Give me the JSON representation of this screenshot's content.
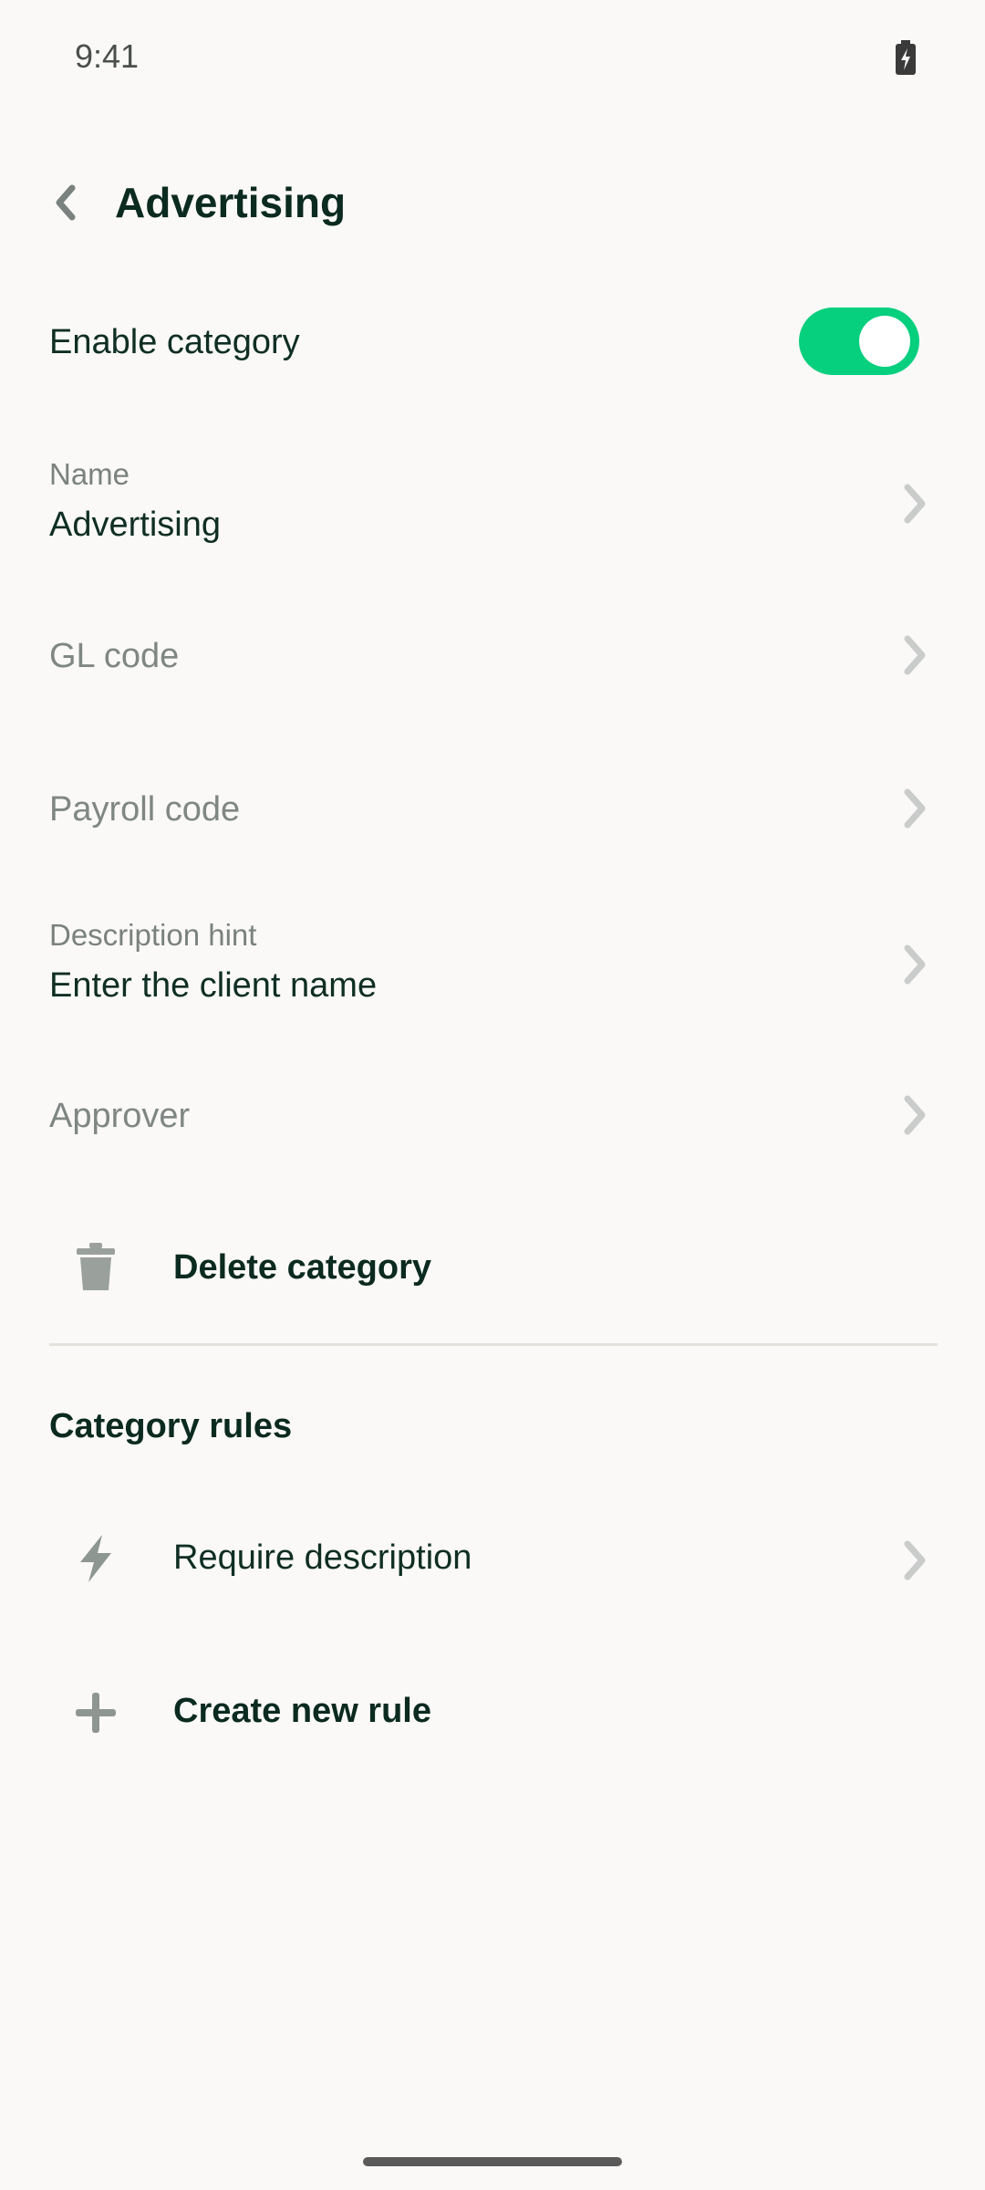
{
  "status_bar": {
    "time": "9:41",
    "battery_icon": "battery-charging-icon"
  },
  "header": {
    "back_icon": "chevron-left-icon",
    "title": "Advertising"
  },
  "enable": {
    "label": "Enable category",
    "enabled": true
  },
  "fields": {
    "name": {
      "label": "Name",
      "value": "Advertising"
    },
    "gl_code": {
      "placeholder": "GL code"
    },
    "payroll_code": {
      "placeholder": "Payroll code"
    },
    "description_hint": {
      "label": "Description hint",
      "value": "Enter the client name"
    },
    "approver": {
      "placeholder": "Approver"
    }
  },
  "delete": {
    "label": "Delete category",
    "icon": "trash-icon"
  },
  "rules": {
    "title": "Category rules",
    "items": [
      {
        "label": "Require description",
        "icon": "lightning-bolt-icon"
      }
    ],
    "create_label": "Create new rule",
    "create_icon": "plus-icon"
  },
  "colors": {
    "accent_green": "#06cf7e",
    "text_dark": "#0b2a20",
    "muted": "#7f8784",
    "background": "#faf9f7"
  }
}
